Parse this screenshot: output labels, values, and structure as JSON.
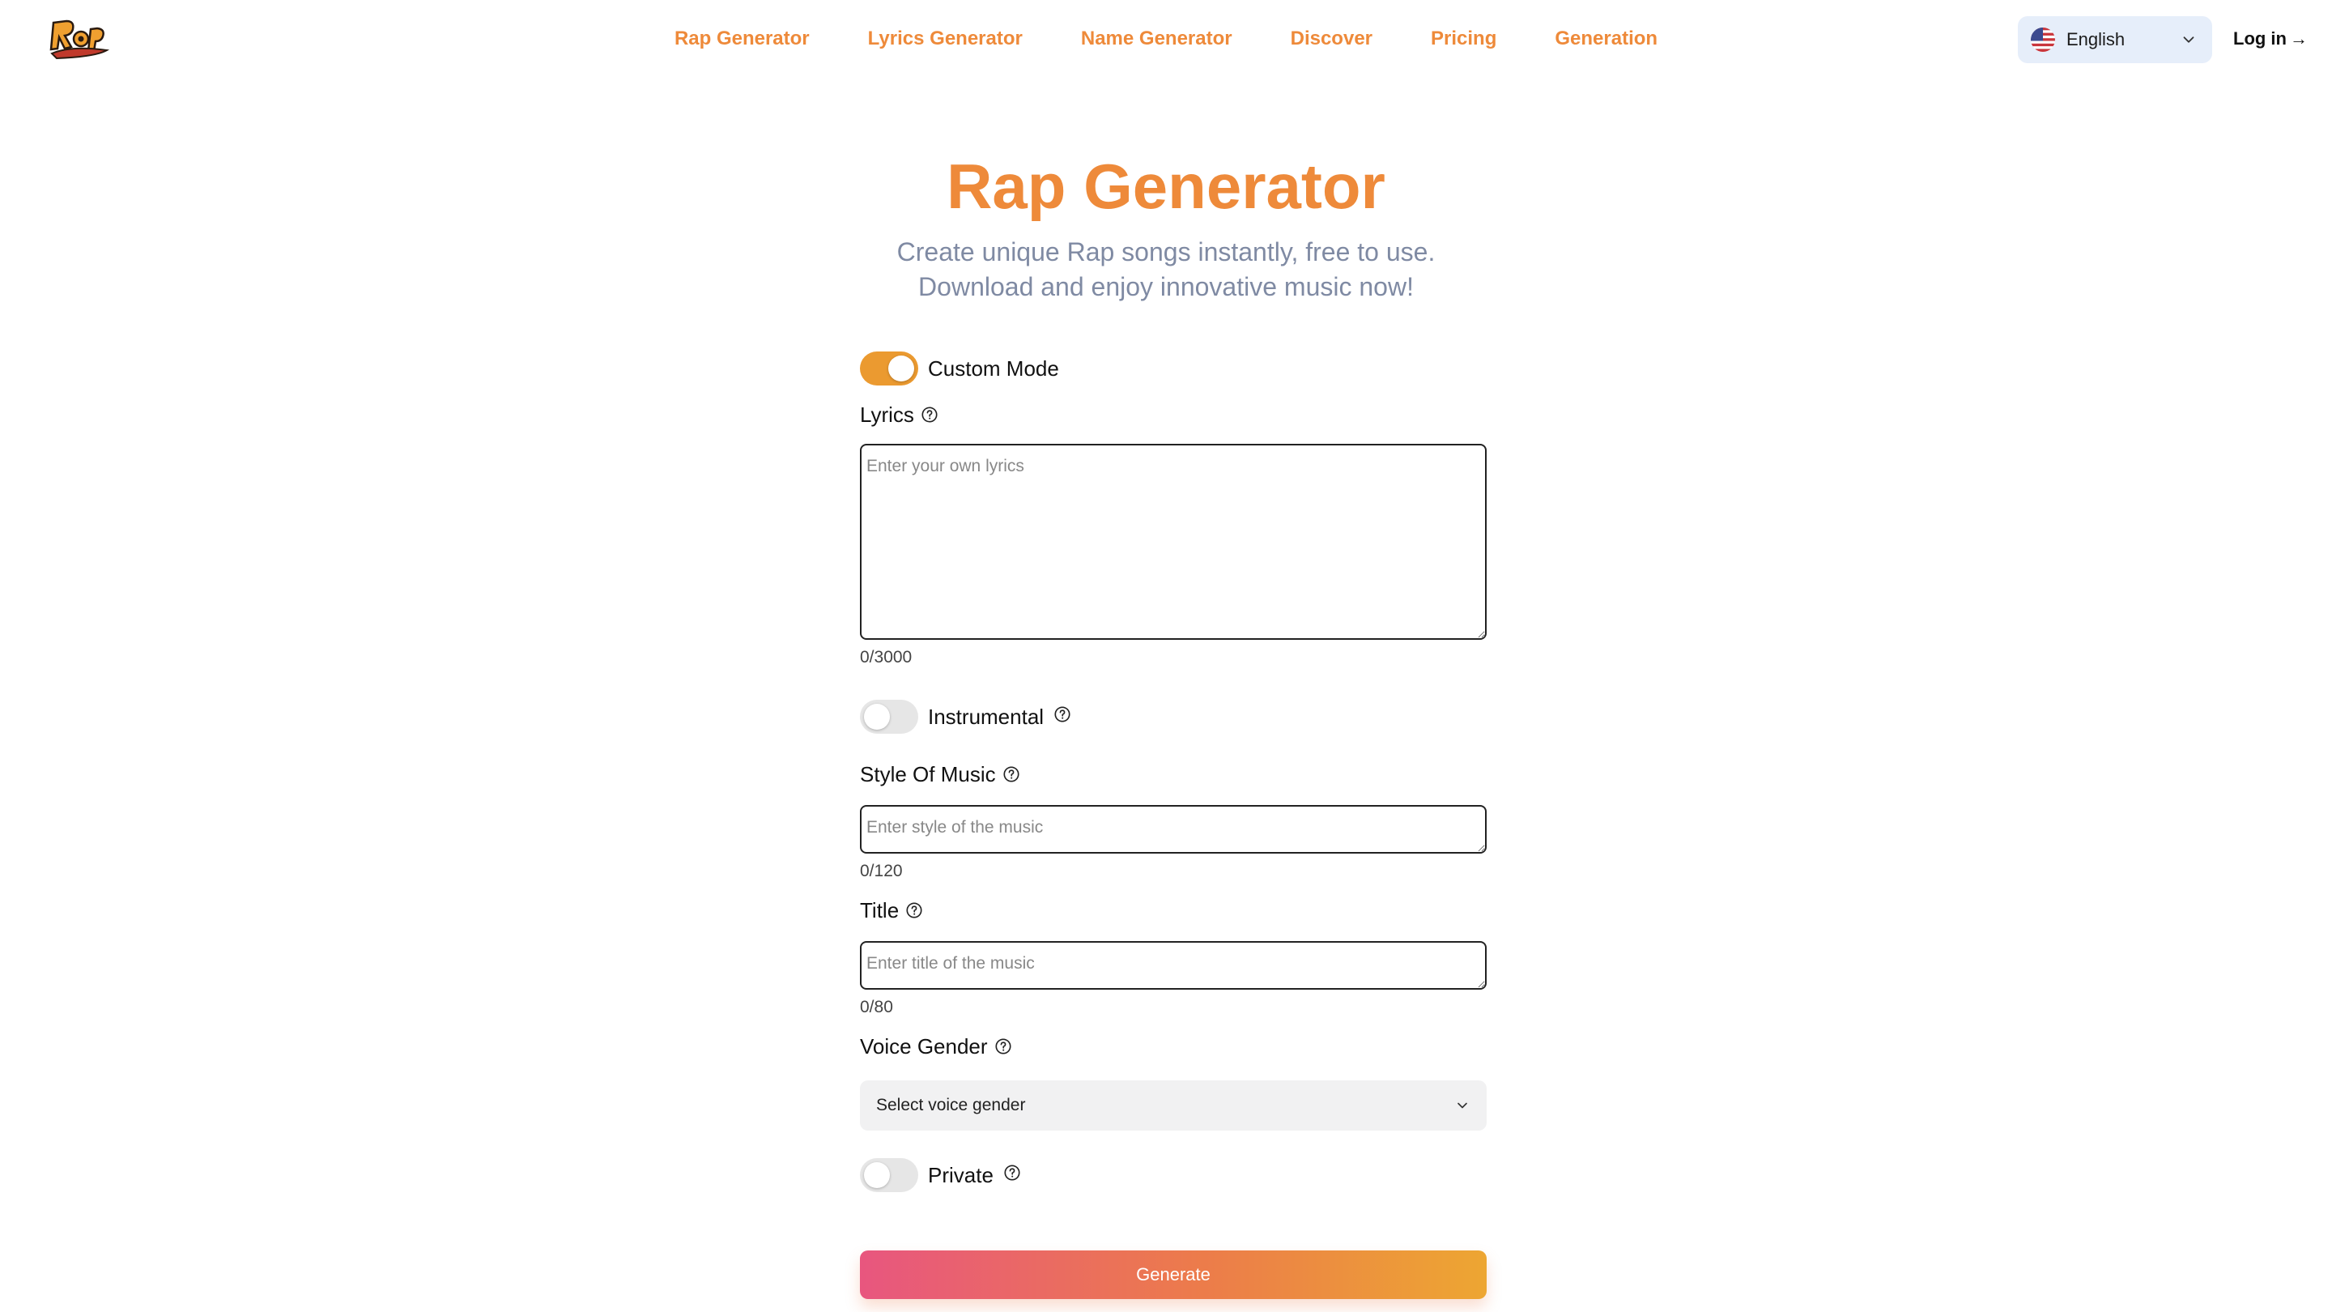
{
  "header": {
    "nav": [
      {
        "label": "Rap Generator"
      },
      {
        "label": "Lyrics Generator"
      },
      {
        "label": "Name Generator"
      },
      {
        "label": "Discover"
      },
      {
        "label": "Pricing"
      },
      {
        "label": "Generation"
      }
    ],
    "language": {
      "selected": "English",
      "flag_icon": "us-flag-icon"
    },
    "login_label": "Log in",
    "login_arrow": "→"
  },
  "hero": {
    "title": "Rap Generator",
    "subtitle_line1": "Create unique Rap songs instantly, free to use.",
    "subtitle_line2": "Download and enjoy innovative music now!"
  },
  "form": {
    "custom_mode": {
      "label": "Custom Mode",
      "on": true
    },
    "lyrics": {
      "label": "Lyrics",
      "placeholder": "Enter your own lyrics",
      "value": "",
      "counter": "0/3000"
    },
    "instrumental": {
      "label": "Instrumental",
      "on": false
    },
    "style": {
      "label": "Style Of Music",
      "placeholder": "Enter style of the music",
      "value": "",
      "counter": "0/120"
    },
    "title": {
      "label": "Title",
      "placeholder": "Enter title of the music",
      "value": "",
      "counter": "0/80"
    },
    "voice_gender": {
      "label": "Voice Gender",
      "placeholder": "Select voice gender"
    },
    "private": {
      "label": "Private",
      "on": false
    },
    "generate_label": "Generate"
  },
  "colors": {
    "accent": "#ee8a3a",
    "toggle_on": "#eb9a30",
    "subtitle": "#7f8aa3",
    "lang_bg": "#e6eefa",
    "gradient_start": "#e8567f",
    "gradient_end": "#eda632"
  }
}
